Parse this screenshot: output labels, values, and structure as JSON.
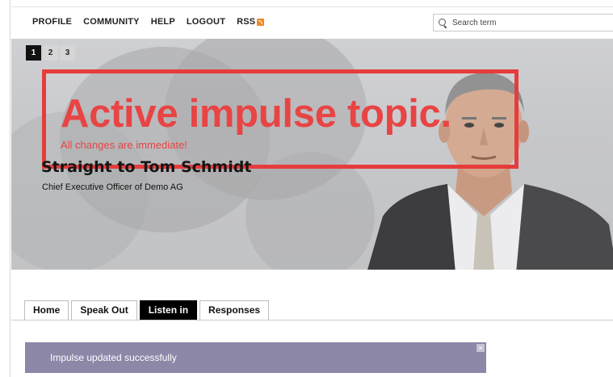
{
  "topnav": {
    "menu": [
      "PROFILE",
      "COMMUNITY",
      "HELP",
      "LOGOUT"
    ],
    "rss_label": "RSS",
    "search_placeholder": "Search term"
  },
  "banner": {
    "pages": [
      "1",
      "2",
      "3"
    ],
    "active_page": "1",
    "headline": "Active impulse topic.",
    "subline": "All changes are immediate!",
    "name_title": "Straight to Tom Schmidt",
    "role": "Chief Executive Officer of Demo AG",
    "accent_color": "#e84444"
  },
  "tabs": [
    {
      "label": "Home",
      "active": false
    },
    {
      "label": "Speak Out",
      "active": false
    },
    {
      "label": "Listen in",
      "active": true
    },
    {
      "label": "Responses",
      "active": false
    }
  ],
  "notice": {
    "text": "Impulse updated successfully",
    "close_icon": "close-icon",
    "color": "#8d87a8"
  }
}
